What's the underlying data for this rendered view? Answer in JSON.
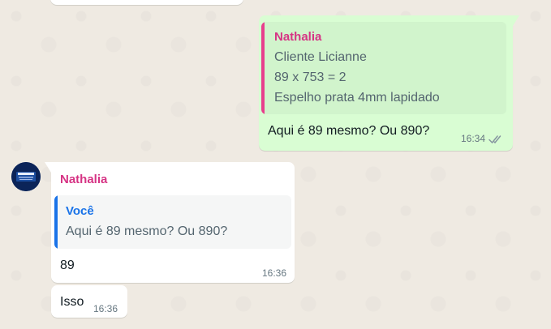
{
  "colors": {
    "wallpaper": "#efeae2",
    "outgoing_bubble": "#d9fdd3",
    "incoming_bubble": "#ffffff",
    "sender_name": "#d63384",
    "quote_you": "#1a73e8"
  },
  "outgoing_message": {
    "quoted_author": "Nathalia",
    "quoted_lines": [
      "Cliente Licianne",
      "89 x 753 = 2",
      "Espelho prata 4mm lapidado"
    ],
    "text": "Aqui é 89 mesmo? Ou 890?",
    "time": "16:34",
    "status_icon": "double-check-icon"
  },
  "incoming_message": {
    "sender": "Nathalia",
    "avatar_icon": "contact-avatar",
    "quoted_author": "Você",
    "quoted_text": "Aqui é 89 mesmo? Ou 890?",
    "text": "89",
    "time": "16:36"
  },
  "incoming_message_2": {
    "text": "Isso",
    "time": "16:36"
  }
}
